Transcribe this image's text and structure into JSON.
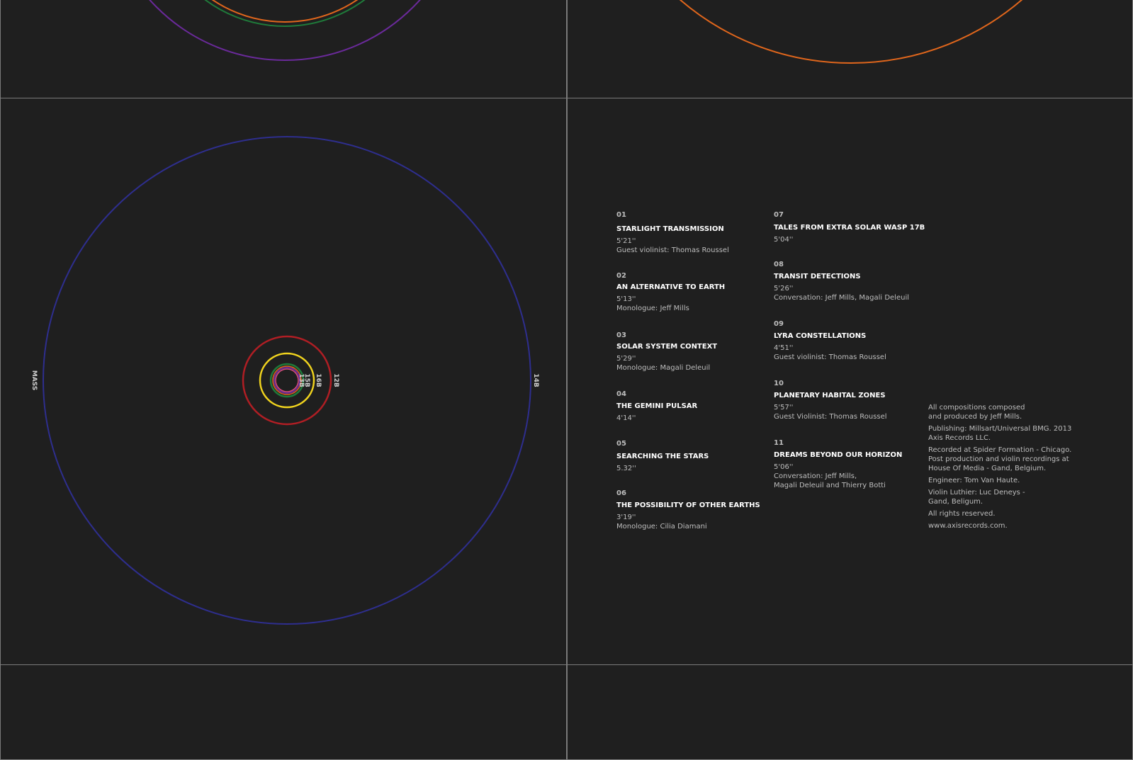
{
  "diagram": {
    "mass_label": "MASS",
    "ring_labels": [
      "14B",
      "12B",
      "16B",
      "15B",
      "13B"
    ]
  },
  "colors": {
    "background": "#1f1f1f",
    "border": "#7a7a7a",
    "ring_blue": "#2e2e8e",
    "ring_red": "#b01e24",
    "ring_yellow": "#f0d31e",
    "ring_green": "#1f7a3a",
    "ring_purple": "#6a2a9a",
    "ring_orange": "#e0661c",
    "ring_pink": "#d8507a"
  },
  "tracks": [
    {
      "num": "01",
      "title": "STARLIGHT TRANSMISSION",
      "duration": "5'21''",
      "note": "Guest violinist: Thomas Roussel"
    },
    {
      "num": "02",
      "title": "AN ALTERNATIVE TO EARTH",
      "duration": "5'13''",
      "note": "Monologue: Jeff Mills"
    },
    {
      "num": "03",
      "title": "SOLAR SYSTEM CONTEXT",
      "duration": "5'29''",
      "note": "Monologue: Magali Deleuil"
    },
    {
      "num": "04",
      "title": "THE GEMINI PULSAR",
      "duration": "4'14''",
      "note": ""
    },
    {
      "num": "05",
      "title": "SEARCHING THE STARS",
      "duration": "5.32''",
      "note": ""
    },
    {
      "num": "06",
      "title": "THE POSSIBILITY OF OTHER EARTHS",
      "duration": "3'19''",
      "note": "Monologue: Cilia Diamani"
    },
    {
      "num": "07",
      "title": "TALES FROM EXTRA SOLAR WASP 17B",
      "duration": "5'04''",
      "note": ""
    },
    {
      "num": "08",
      "title": "TRANSIT DETECTIONS",
      "duration": "5'26''",
      "note": "Conversation: Jeff Mills, Magali Deleuil"
    },
    {
      "num": "09",
      "title": "LYRA CONSTELLATIONS",
      "duration": "4'51''",
      "note": "Guest violinist: Thomas Roussel"
    },
    {
      "num": "10",
      "title": "PLANETARY HABITAL ZONES",
      "duration": "5'57''",
      "note": "Guest Violinist: Thomas Roussel"
    },
    {
      "num": "11",
      "title": "DREAMS BEYOND OUR HORIZON",
      "duration": "5'06''",
      "note": "Conversation: Jeff Mills,",
      "note2": "Magali Deleuil and Thierry Botti"
    }
  ],
  "credits": [
    "All compositions composed\nand produced by Jeff Mills.",
    "Publishing: Millsart/Universal BMG. 2013\nAxis Records LLC.",
    "Recorded at Spider Formation - Chicago.\nPost production and violin recordings at\nHouse Of Media - Gand, Belgium.",
    "Engineer: Tom Van Haute.",
    "Violin Luthier: Luc Deneys -\nGand, Beligum.",
    "All rights reserved.",
    "www.axisrecords.com."
  ]
}
